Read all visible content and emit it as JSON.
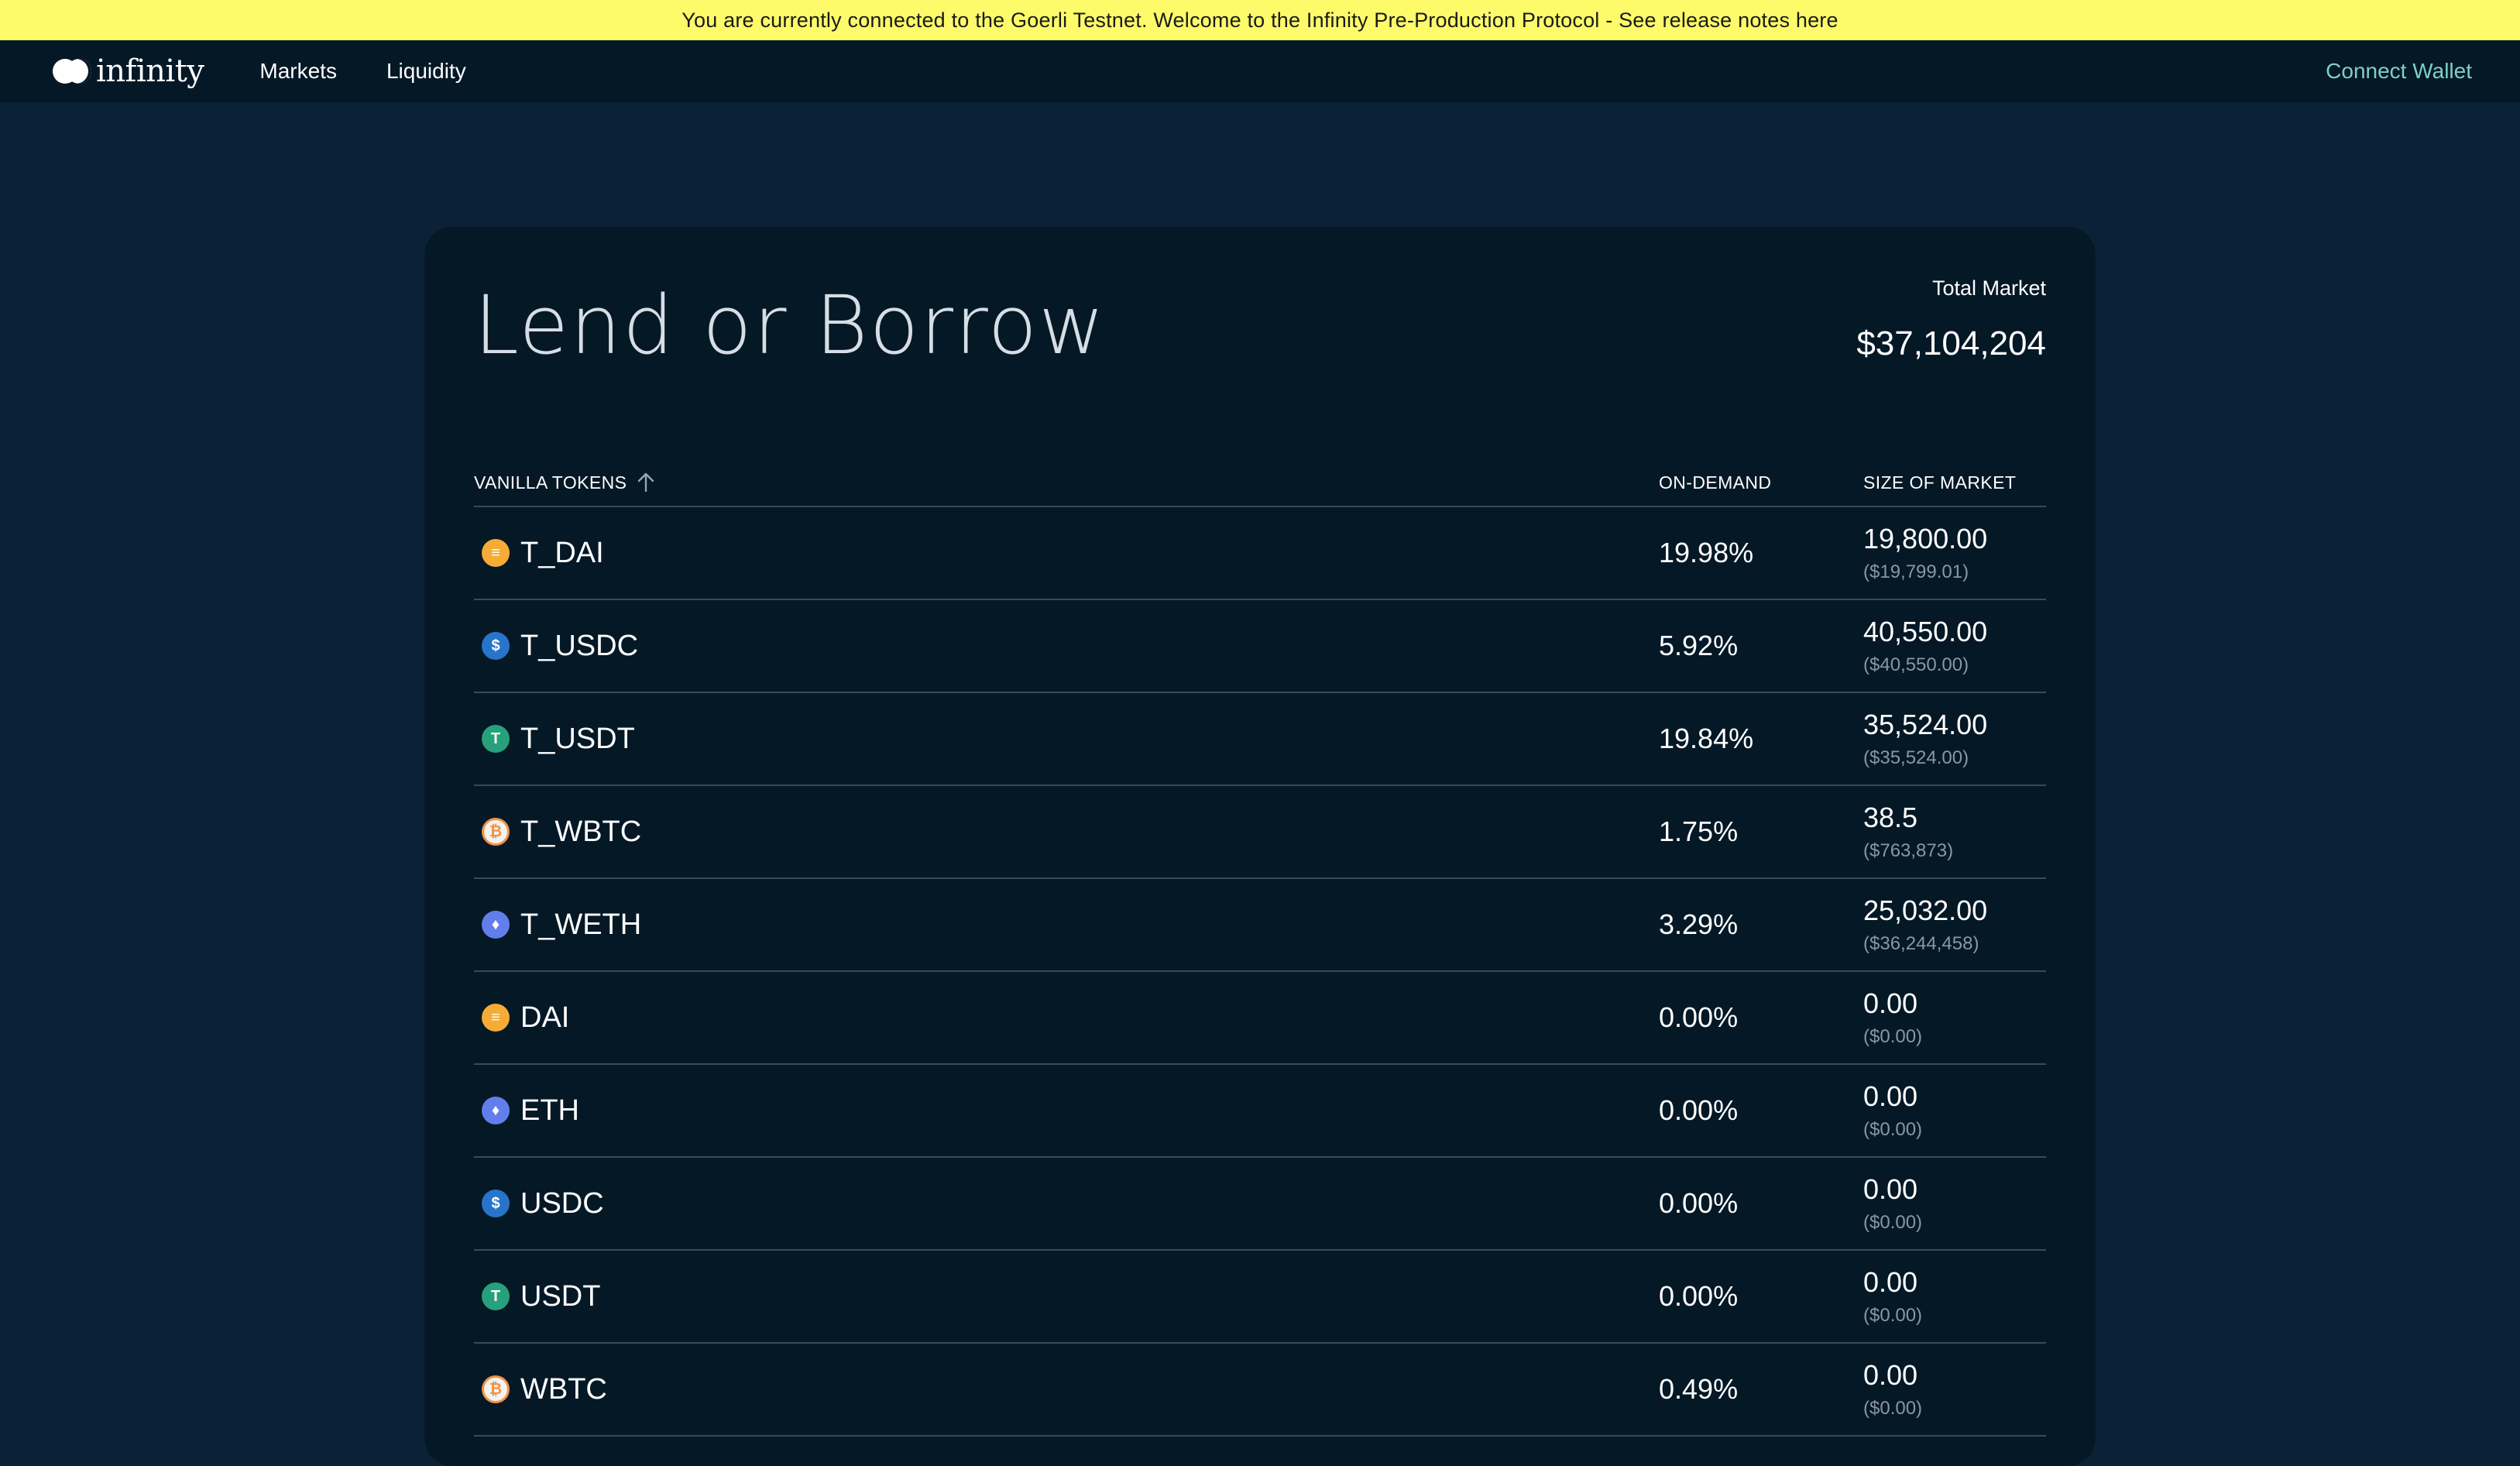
{
  "banner": {
    "text": "You are currently connected to the Goerli Testnet. Welcome to the Infinity Pre-Production Protocol - See release notes here"
  },
  "nav": {
    "logo_text": "infinity",
    "links": [
      "Markets",
      "Liquidity"
    ],
    "connect_label": "Connect Wallet"
  },
  "panel": {
    "title": "Lend or Borrow",
    "total_label": "Total Market",
    "total_value": "$37,104,204"
  },
  "table": {
    "headers": {
      "token": "VANILLA TOKENS",
      "demand": "ON-DEMAND",
      "size": "SIZE OF MARKET"
    },
    "rows": [
      {
        "icon": "dai-coin-icon",
        "name": "T_DAI",
        "demand": "19.98%",
        "size": "19,800.00",
        "size_usd": "($19,799.01)"
      },
      {
        "icon": "usdc-coin-icon",
        "name": "T_USDC",
        "demand": "5.92%",
        "size": "40,550.00",
        "size_usd": "($40,550.00)"
      },
      {
        "icon": "usdt-coin-icon",
        "name": "T_USDT",
        "demand": "19.84%",
        "size": "35,524.00",
        "size_usd": "($35,524.00)"
      },
      {
        "icon": "wbtc-coin-icon",
        "name": "T_WBTC",
        "demand": "1.75%",
        "size": "38.5",
        "size_usd": "($763,873)"
      },
      {
        "icon": "eth-coin-icon",
        "name": "T_WETH",
        "demand": "3.29%",
        "size": "25,032.00",
        "size_usd": "($36,244,458)"
      },
      {
        "icon": "dai-coin-icon",
        "name": "DAI",
        "demand": "0.00%",
        "size": "0.00",
        "size_usd": "($0.00)"
      },
      {
        "icon": "eth-coin-icon",
        "name": "ETH",
        "demand": "0.00%",
        "size": "0.00",
        "size_usd": "($0.00)"
      },
      {
        "icon": "usdc-coin-icon",
        "name": "USDC",
        "demand": "0.00%",
        "size": "0.00",
        "size_usd": "($0.00)"
      },
      {
        "icon": "usdt-coin-icon",
        "name": "USDT",
        "demand": "0.00%",
        "size": "0.00",
        "size_usd": "($0.00)"
      },
      {
        "icon": "wbtc-coin-icon",
        "name": "WBTC",
        "demand": "0.49%",
        "size": "0.00",
        "size_usd": "($0.00)"
      }
    ]
  },
  "colors": {
    "banner_bg": "#fdfb6a",
    "page_bg": "#0b2236",
    "panel_bg": "#051826",
    "accent": "#7fd0c4"
  }
}
